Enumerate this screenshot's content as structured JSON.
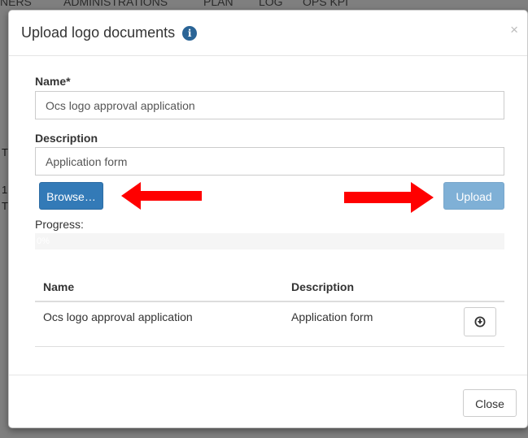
{
  "background": {
    "nav_items": [
      "NERS",
      "ADMINISTRATIONS",
      "PLAN",
      "LOG",
      "OPS KPI"
    ],
    "fragments": [
      "T",
      "1",
      "T"
    ]
  },
  "modal": {
    "title": "Upload logo documents",
    "info_icon": "i",
    "close_glyph": "×",
    "name_label": "Name*",
    "name_value": "Ocs logo approval application",
    "description_label": "Description",
    "description_value": "Application form",
    "browse_label": "Browse…",
    "upload_label": "Upload",
    "progress_label": "Progress:",
    "progress_text": "0%",
    "progress_value": 0,
    "table": {
      "headers": [
        "Name",
        "Description"
      ],
      "rows": [
        {
          "name": "Ocs logo approval application",
          "description": "Application form",
          "action_icon": "download-circle-icon"
        }
      ]
    },
    "close_button_label": "Close"
  },
  "colors": {
    "primary": "#337ab7",
    "primary_disabled": "#7fb0d6",
    "annotation_arrow": "#ff0000",
    "info_icon": "#2a6496"
  }
}
